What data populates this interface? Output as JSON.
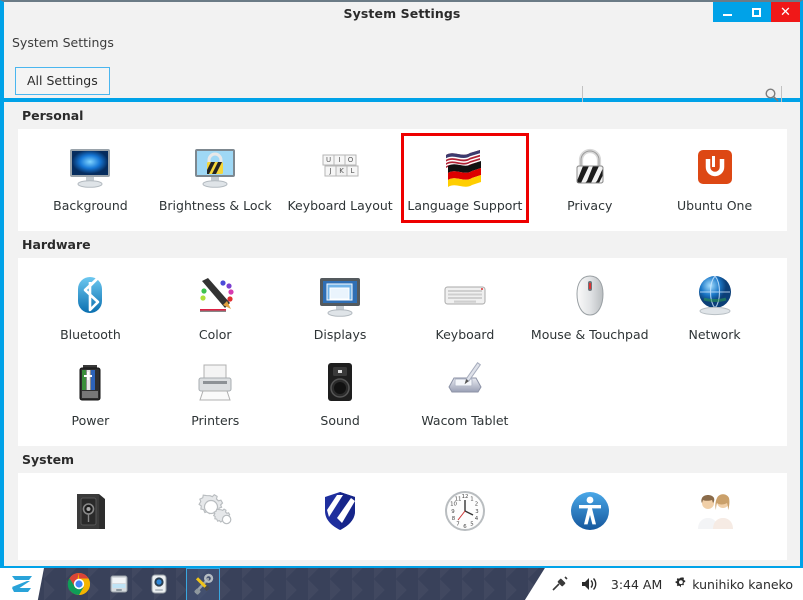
{
  "window": {
    "title": "System Settings",
    "buttons": {
      "minimize": "minimize-icon",
      "maximize": "maximize-icon",
      "close": "✕"
    }
  },
  "toolbar": {
    "app_label": "System Settings",
    "all_settings_label": "All Settings",
    "search": {
      "value": "",
      "placeholder": "",
      "icon": "search-icon"
    }
  },
  "sections": [
    {
      "title": "Personal",
      "items": [
        {
          "label": "Background",
          "icon": "monitor-background-icon",
          "highlighted": false
        },
        {
          "label": "Brightness & Lock",
          "icon": "monitor-lock-icon",
          "highlighted": false
        },
        {
          "label": "Keyboard Layout",
          "icon": "keyboard-keys-icon",
          "highlighted": false
        },
        {
          "label": "Language Support",
          "icon": "flags-icon",
          "highlighted": true
        },
        {
          "label": "Privacy",
          "icon": "padlock-icon",
          "highlighted": false
        },
        {
          "label": "Ubuntu One",
          "icon": "ubuntu-one-icon",
          "highlighted": false
        }
      ]
    },
    {
      "title": "Hardware",
      "items": [
        {
          "label": "Bluetooth",
          "icon": "bluetooth-icon",
          "highlighted": false
        },
        {
          "label": "Color",
          "icon": "color-pencil-icon",
          "highlighted": false
        },
        {
          "label": "Displays",
          "icon": "displays-icon",
          "highlighted": false
        },
        {
          "label": "Keyboard",
          "icon": "keyboard-icon",
          "highlighted": false
        },
        {
          "label": "Mouse & Touchpad",
          "icon": "mouse-icon",
          "highlighted": false
        },
        {
          "label": "Network",
          "icon": "globe-network-icon",
          "highlighted": false
        },
        {
          "label": "Power",
          "icon": "battery-icon",
          "highlighted": false
        },
        {
          "label": "Printers",
          "icon": "printer-icon",
          "highlighted": false
        },
        {
          "label": "Sound",
          "icon": "speaker-icon",
          "highlighted": false
        },
        {
          "label": "Wacom Tablet",
          "icon": "tablet-pen-icon",
          "highlighted": false
        }
      ]
    },
    {
      "title": "System",
      "items": [
        {
          "label": "",
          "icon": "safe-details-icon",
          "highlighted": false
        },
        {
          "label": "",
          "icon": "gears-software-icon",
          "highlighted": false
        },
        {
          "label": "",
          "icon": "shield-security-icon",
          "highlighted": false
        },
        {
          "label": "",
          "icon": "clock-icon",
          "highlighted": false
        },
        {
          "label": "",
          "icon": "universal-access-icon",
          "highlighted": false
        },
        {
          "label": "",
          "icon": "user-accounts-icon",
          "highlighted": false
        }
      ]
    }
  ],
  "taskbar": {
    "start": "zorin-logo-icon",
    "apps": [
      {
        "name": "chrome-icon",
        "active": false
      },
      {
        "name": "file-manager-icon",
        "active": false
      },
      {
        "name": "camera-icon",
        "active": false
      },
      {
        "name": "tools-settings-icon",
        "active": true
      }
    ],
    "tray": {
      "network_icon": "plug-icon",
      "volume_icon": "volume-icon",
      "clock": "3:44 AM",
      "user_icon": "gear-icon",
      "user": "kunihiko kaneko"
    }
  },
  "colors": {
    "accent": "#00a2e8",
    "close": "#f01818",
    "highlight": "#ee0000",
    "taskbar": "#39415a"
  }
}
